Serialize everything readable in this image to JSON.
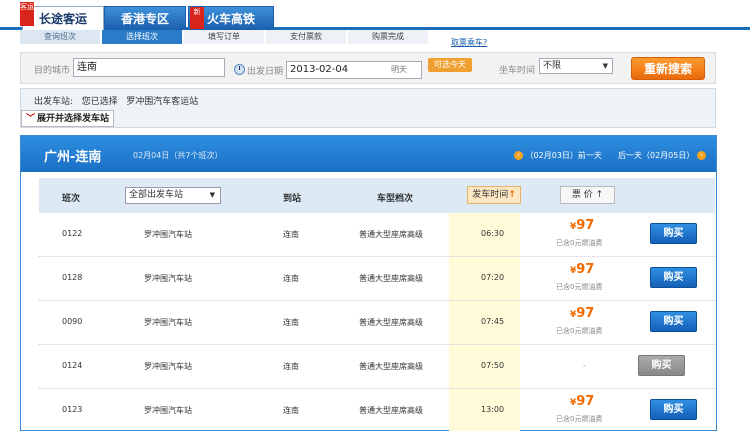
{
  "tabs": {
    "long_distance": "长途客运",
    "long_distance_ribbon": "客运",
    "hong_kong": "香港专区",
    "rail": "火车高铁",
    "rail_ribbon": "新"
  },
  "steps": [
    "查询班次",
    "选择班次",
    "填写订单",
    "支付票款",
    "购票完成"
  ],
  "help_link": "取票乘车?",
  "search": {
    "dest_label": "目的城市",
    "dest_value": "连南",
    "date_label": "出发日期",
    "date_value": "2013-02-04",
    "date_day": "明天",
    "today_btn": "可选今天",
    "time_label": "坐车时间",
    "time_value": "不限",
    "search_btn": "重新搜索"
  },
  "station": {
    "label": "出发车站:",
    "selected_text": "您已选择",
    "selected_station": "罗冲围汽车客运站",
    "expand": "展开并选择发车站"
  },
  "panel": {
    "route": "广州-连南",
    "subtitle": "02月04日（共7个班次）",
    "prev_day": "（02月03日）前一天",
    "next_day": "后一天（02月05日）"
  },
  "columns": {
    "number": "班次",
    "station_select": "全部出发车站",
    "arrive": "到站",
    "type": "车型档次",
    "time_sort": "发车时间",
    "price_sort": "票 价"
  },
  "rows": [
    {
      "number": "0122",
      "station": "罗冲围汽车站",
      "arrive": "连南",
      "type": "普通大型座席高级",
      "time": "06:30",
      "price": "97",
      "note": "已含0元燃油费",
      "buy": "购买",
      "available": true
    },
    {
      "number": "0128",
      "station": "罗冲围汽车站",
      "arrive": "连南",
      "type": "普通大型座席高级",
      "time": "07:20",
      "price": "97",
      "note": "已含0元燃油费",
      "buy": "购买",
      "available": true
    },
    {
      "number": "0090",
      "station": "罗冲围汽车站",
      "arrive": "连南",
      "type": "普通大型座席高级",
      "time": "07:45",
      "price": "97",
      "note": "已含0元燃油费",
      "buy": "购买",
      "available": true
    },
    {
      "number": "0124",
      "station": "罗冲围汽车站",
      "arrive": "连南",
      "type": "普通大型座席高级",
      "time": "07:50",
      "price": "-",
      "note": "",
      "buy": "购买",
      "available": false
    },
    {
      "number": "0123",
      "station": "罗冲围汽车站",
      "arrive": "连南",
      "type": "普通大型座席高级",
      "time": "13:00",
      "price": "97",
      "note": "已含0元燃油费",
      "buy": "购买",
      "available": true
    }
  ],
  "colors": {
    "accent_blue": "#1a6fc4",
    "orange": "#f06a00",
    "highlight_yellow": "#fffbd9"
  }
}
